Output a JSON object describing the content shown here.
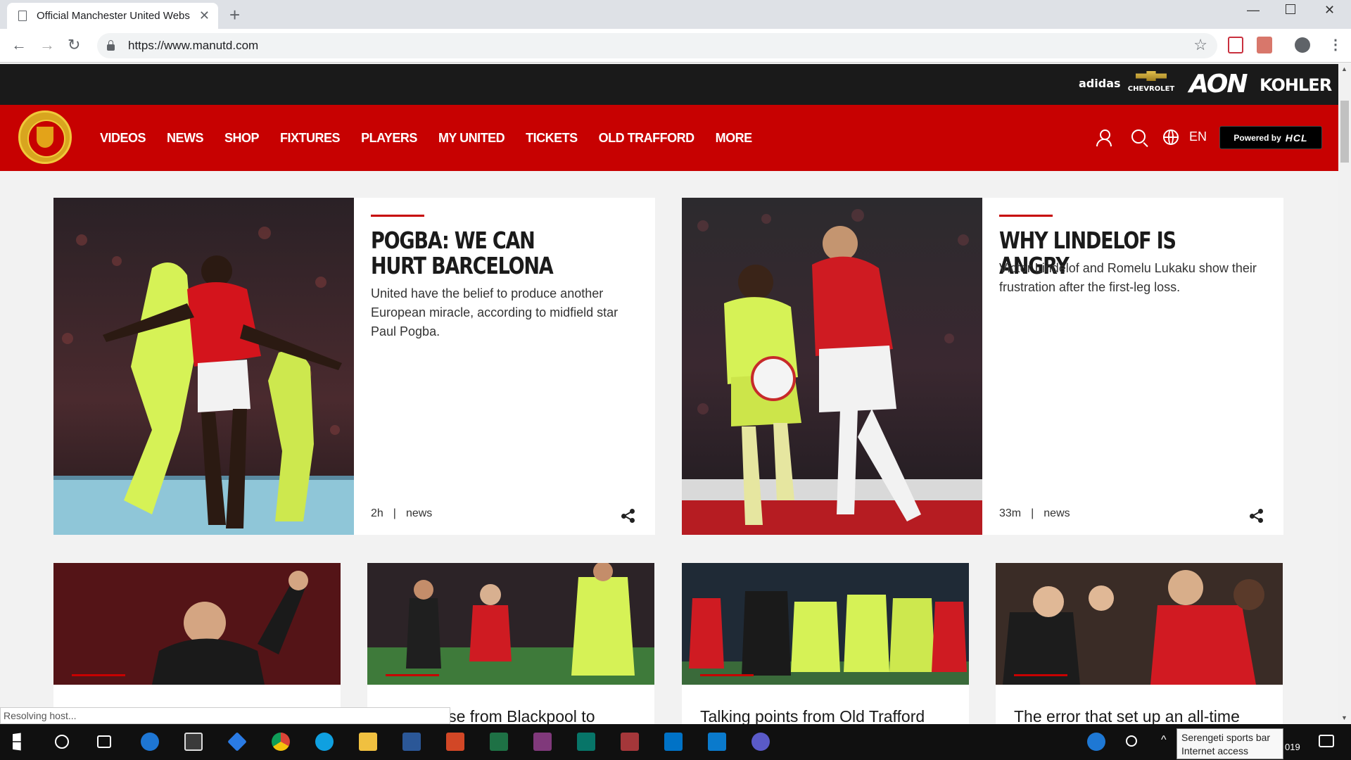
{
  "browser": {
    "tab_title": "Official Manchester United Webs",
    "url": "https://www.manutd.com",
    "new_tab": "+",
    "close_tab": "✕",
    "status_text": "Resolving host..."
  },
  "sponsors": [
    "adidas",
    "CHEVROLET",
    "AON",
    "KOHLER"
  ],
  "nav": {
    "items": [
      "VIDEOS",
      "NEWS",
      "SHOP",
      "FIXTURES",
      "PLAYERS",
      "MY UNITED",
      "TICKETS",
      "OLD TRAFFORD",
      "MORE"
    ],
    "lang": "EN",
    "powered_by": "Powered by",
    "powered_brand": "HCL"
  },
  "featured": [
    {
      "headline": "POGBA: WE CAN HURT BARCELONA",
      "summary": "United have the belief to produce another European miracle, according to midfield star Paul Pogba.",
      "time": "2h",
      "category": "news"
    },
    {
      "headline": "WHY LINDELOF IS ANGRY",
      "summary": "Victor Lindelof and Romelu Lukaku show their frustration after the first-leg loss.",
      "time": "33m",
      "category": "news"
    }
  ],
  "small_cards": [
    {
      "title": ""
    },
    {
      "title": "ise from Blackpool to"
    },
    {
      "title": "Talking points from Old Trafford"
    },
    {
      "title": "The error that set up an all-time"
    }
  ],
  "taskbar": {
    "tooltip_line1": "Serengeti sports bar",
    "tooltip_line2": "Internet access",
    "time_fragment": "019"
  },
  "colors": {
    "brand_red": "#c70101",
    "sponsor_bar": "#1a1a1a",
    "barca_kit": "#d6f256"
  }
}
